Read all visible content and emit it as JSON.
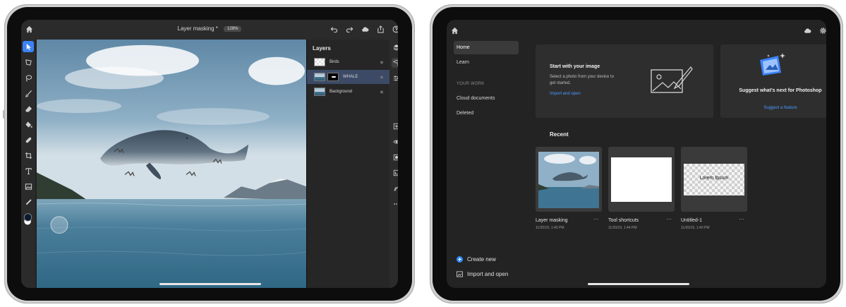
{
  "editor": {
    "document_title": "Layer masking *",
    "zoom": "128%",
    "layers_panel": {
      "title": "Layers",
      "layers": [
        {
          "name": "Birds",
          "visible": true,
          "selected": false
        },
        {
          "name": "WHALE",
          "visible": true,
          "selected": true
        },
        {
          "name": "Background",
          "visible": true,
          "selected": false
        }
      ]
    },
    "colors": {
      "accent": "#3b82f6",
      "panel_bg": "#262626",
      "selected_layer": "#3c4a66"
    },
    "top_icons": [
      "home-icon",
      "undo-icon",
      "redo-icon",
      "cloud-icon",
      "share-icon",
      "help-icon"
    ],
    "tools": [
      "move-tool-icon",
      "transform-tool-icon",
      "lasso-tool-icon",
      "brush-tool-icon",
      "eraser-tool-icon",
      "fill-tool-icon",
      "healing-tool-icon",
      "crop-tool-icon",
      "type-tool-icon",
      "place-image-icon",
      "eyedropper-icon",
      "color-swatch"
    ],
    "rail_icons": [
      "layers-icon",
      "layer-properties-icon",
      "adjustments-icon",
      "add-layer-icon",
      "visibility-icon",
      "mask-icon",
      "clipping-icon",
      "refine-edge-icon",
      "more-icon"
    ]
  },
  "home": {
    "nav": {
      "items": [
        {
          "label": "Home",
          "active": true
        },
        {
          "label": "Learn",
          "active": false
        }
      ],
      "section_label": "YOUR WORK",
      "work_items": [
        {
          "label": "Cloud documents"
        },
        {
          "label": "Deleted"
        }
      ]
    },
    "start_card": {
      "title": "Start with your image",
      "text": "Select a photo from your device to get started.",
      "link": "Import and open"
    },
    "suggest_card": {
      "title": "Suggest what’s next for Photoshop",
      "link": "Suggest a feature"
    },
    "recent": {
      "label": "Recent",
      "items": [
        {
          "name": "Layer masking",
          "date": "11/20/19, 1:45 PM"
        },
        {
          "name": "Tool shortcuts",
          "date": "11/20/19, 1:44 PM"
        },
        {
          "name": "Untitled-1",
          "date": "11/20/19, 1:40 PM",
          "thumb_text": "Lorem Ipsum"
        }
      ]
    },
    "actions": {
      "create_new": "Create new",
      "import_open": "Import and open"
    },
    "colors": {
      "link": "#4a9bff",
      "create_icon": "#2d8cff"
    }
  }
}
